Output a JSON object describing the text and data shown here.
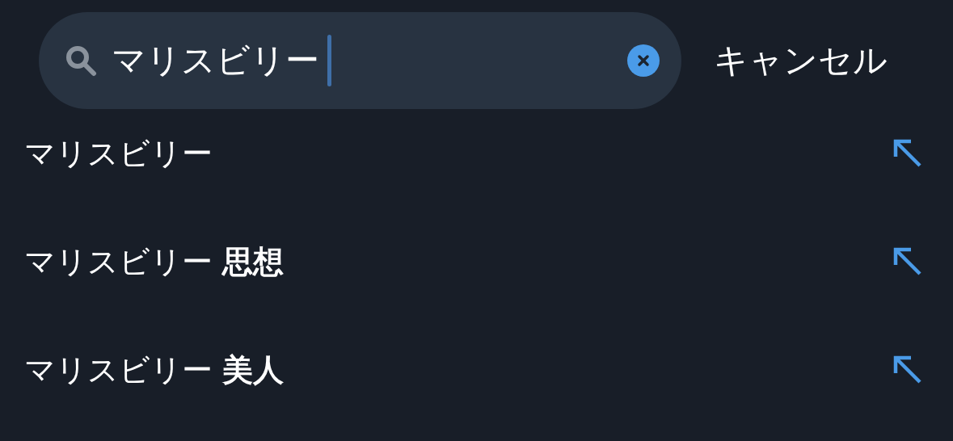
{
  "search": {
    "value": "マリスビリー",
    "focused": true
  },
  "cancel": "キャンセル",
  "suggestions": [
    {
      "text": "マリスビリー"
    },
    {
      "text": "マリスビリー **思想**"
    },
    {
      "text": "マリスビリー **美人**"
    }
  ]
}
